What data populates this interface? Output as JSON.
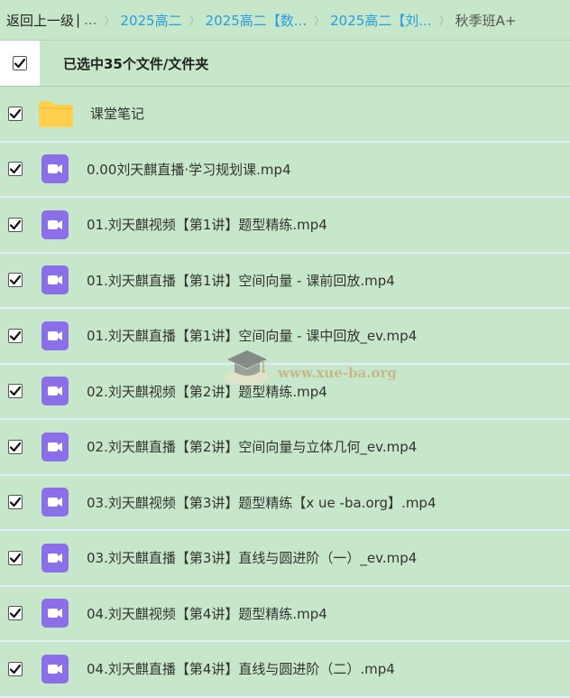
{
  "breadcrumb": {
    "back": "返回上一级",
    "separator": "|",
    "ellipsis": "...",
    "items": [
      "2025高二",
      "2025高二【数...",
      "2025高二【刘..."
    ],
    "current": "秋季班A+"
  },
  "selection": {
    "text": "已选中35个文件/文件夹",
    "all_checked": true
  },
  "files": [
    {
      "name": "课堂笔记",
      "type": "folder",
      "checked": true
    },
    {
      "name": "0.00刘天麒直播·学习规划课.mp4",
      "type": "video",
      "checked": true
    },
    {
      "name": "01.刘天麒视频【第1讲】题型精练.mp4",
      "type": "video",
      "checked": true
    },
    {
      "name": "01.刘天麒直播【第1讲】空间向量 - 课前回放.mp4",
      "type": "video",
      "checked": true
    },
    {
      "name": "01.刘天麒直播【第1讲】空间向量 - 课中回放_ev.mp4",
      "type": "video",
      "checked": true
    },
    {
      "name": "02.刘天麒视频【第2讲】题型精练.mp4",
      "type": "video",
      "checked": true
    },
    {
      "name": "02.刘天麒直播【第2讲】空间向量与立体几何_ev.mp4",
      "type": "video",
      "checked": true
    },
    {
      "name": "03.刘天麒视频【第3讲】题型精练【x ue -ba.org】.mp4",
      "type": "video",
      "checked": true
    },
    {
      "name": "03.刘天麒直播【第3讲】直线与圆进阶（一）_ev.mp4",
      "type": "video",
      "checked": true
    },
    {
      "name": "04.刘天麒视频【第4讲】题型精练.mp4",
      "type": "video",
      "checked": true
    },
    {
      "name": "04.刘天麒直播【第4讲】直线与圆进阶（二）.mp4",
      "type": "video",
      "checked": true
    }
  ],
  "watermark": {
    "text": "www.xue-ba.org"
  },
  "colors": {
    "background": "#c6e7c9",
    "link": "#2a9be0",
    "video_icon": "#8b6fe8",
    "folder_icon": "#ffd04d"
  }
}
